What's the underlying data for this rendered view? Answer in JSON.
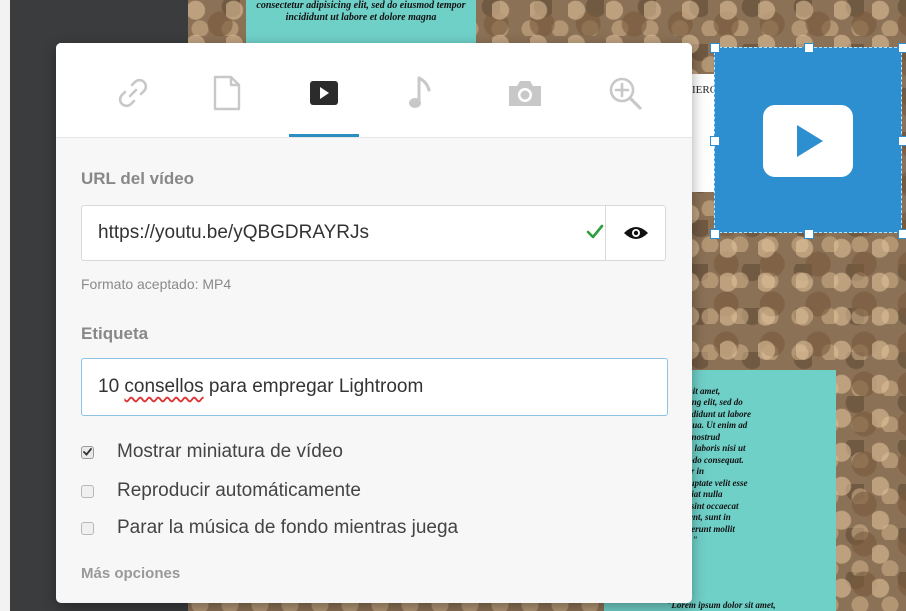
{
  "background": {
    "text_top": "consectetur adipisicing elit, sed do eiusmod tempor incididunt ut labore et dolore magna",
    "label_card": "IERO 3",
    "text_right": "Lorem ipsum dolor sit amet,\nconsectetur adipisicing elit, sed do\neiusmod tempor incididunt ut labore\net dolore magna aliqua. Ut enim ad\nminim veniam, quis nostrud\nexercitation ullamco laboris nisi ut\naliquip ex ea commodo consequat.\nDuis aute irure dolor in\nreprehenderit in voluptate velit esse\ncillum dolore eu fugiat nulla\npariatur. Excepteur sint occaecat\ncupidatat non proident, sunt in\nculpa qui officia deserunt mollit\nanim id est laborum.\"",
    "text_right_bottom": "\"Lorem ipsum dolor sit amet,"
  },
  "tabs": [
    {
      "icon": "link-icon",
      "active": false
    },
    {
      "icon": "document-icon",
      "active": false
    },
    {
      "icon": "video-play-icon",
      "active": true
    },
    {
      "icon": "music-note-icon",
      "active": false
    },
    {
      "icon": "camera-icon",
      "active": false
    },
    {
      "icon": "zoom-in-icon",
      "active": false
    }
  ],
  "video_url": {
    "label": "URL del vídeo",
    "value": "https://youtu.be/yQBGDRAYRJs",
    "hint": "Formato aceptado: MP4"
  },
  "etiqueta": {
    "label": "Etiqueta",
    "value_prefix": "10 ",
    "value_misspelled": "consellos",
    "value_suffix": " para empregar Lightroom"
  },
  "options": [
    {
      "label": "Mostrar miniatura de vídeo",
      "checked": true
    },
    {
      "label": "Reproducir automáticamente",
      "checked": false
    },
    {
      "label": "Parar la música de fondo mientras juega",
      "checked": false
    }
  ],
  "more_options": "Más opciones",
  "colors": {
    "accent": "#2a8fc0",
    "valid_check": "#2e9e3e",
    "video_block": "#2e8fd0",
    "teal_text_box": "#6fd0c8"
  }
}
